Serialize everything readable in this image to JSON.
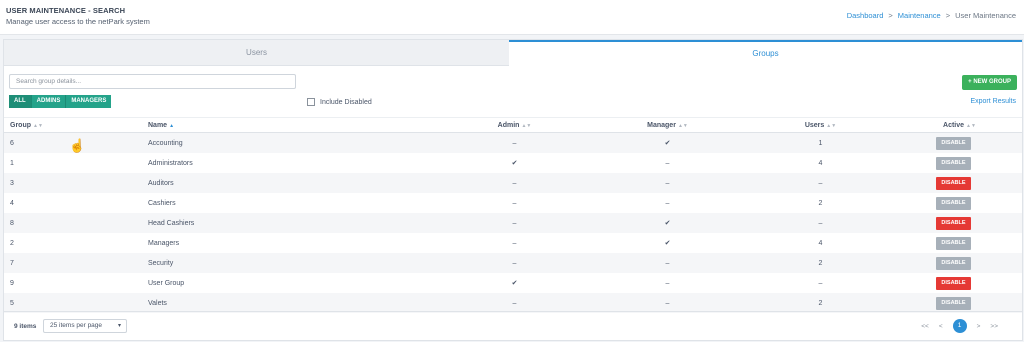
{
  "header": {
    "title": "USER MAINTENANCE - SEARCH",
    "subtitle": "Manage user access to the netPark system",
    "breadcrumb": [
      "Dashboard",
      "Maintenance",
      "User Maintenance"
    ]
  },
  "tabs": [
    {
      "label": "Users",
      "active": false
    },
    {
      "label": "Groups",
      "active": true
    }
  ],
  "search": {
    "placeholder": "Search group details...",
    "value": ""
  },
  "filters": [
    "ALL",
    "ADMINS",
    "MANAGERS"
  ],
  "include_disabled": {
    "label": "Include Disabled",
    "checked": false
  },
  "new_group_label": "+ NEW GROUP",
  "export_label": "Export Results",
  "columns": [
    "Group",
    "Name",
    "Admin",
    "Manager",
    "Users",
    "Active"
  ],
  "rows": [
    {
      "group": "6",
      "name": "Accounting",
      "admin": "–",
      "manager": "✔",
      "users": "1",
      "active": "DISABLE",
      "status": "grey"
    },
    {
      "group": "1",
      "name": "Administrators",
      "admin": "✔",
      "manager": "–",
      "users": "4",
      "active": "DISABLE",
      "status": "grey"
    },
    {
      "group": "3",
      "name": "Auditors",
      "admin": "–",
      "manager": "–",
      "users": "–",
      "active": "DISABLE",
      "status": "red"
    },
    {
      "group": "4",
      "name": "Cashiers",
      "admin": "–",
      "manager": "–",
      "users": "2",
      "active": "DISABLE",
      "status": "grey"
    },
    {
      "group": "8",
      "name": "Head Cashiers",
      "admin": "–",
      "manager": "✔",
      "users": "–",
      "active": "DISABLE",
      "status": "red"
    },
    {
      "group": "2",
      "name": "Managers",
      "admin": "–",
      "manager": "✔",
      "users": "4",
      "active": "DISABLE",
      "status": "grey"
    },
    {
      "group": "7",
      "name": "Security",
      "admin": "–",
      "manager": "–",
      "users": "2",
      "active": "DISABLE",
      "status": "grey"
    },
    {
      "group": "9",
      "name": "User Group",
      "admin": "✔",
      "manager": "–",
      "users": "–",
      "active": "DISABLE",
      "status": "red"
    },
    {
      "group": "5",
      "name": "Valets",
      "admin": "–",
      "manager": "–",
      "users": "2",
      "active": "DISABLE",
      "status": "grey"
    }
  ],
  "footer": {
    "item_count": "9 items",
    "per_page": "25 items per page",
    "pager": [
      "<<",
      "<",
      "1",
      ">",
      ">>"
    ]
  },
  "colors": {
    "accent": "#2d8fd5",
    "teal": "#24a38a",
    "green": "#3bb15c",
    "red": "#e53935",
    "grey": "#a7b0b9"
  }
}
